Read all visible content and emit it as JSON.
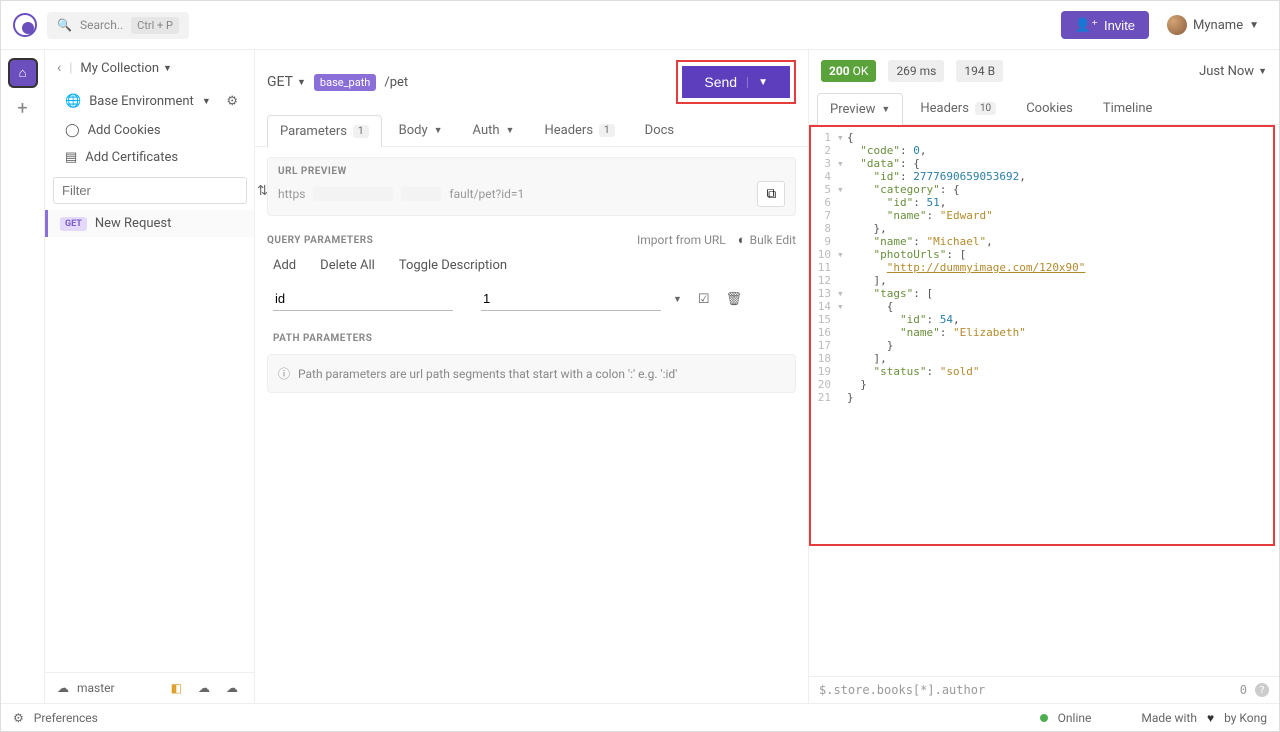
{
  "topbar": {
    "search_placeholder": "Search..",
    "shortcut": "Ctrl + P",
    "invite": "Invite",
    "username": "Myname"
  },
  "sidebar": {
    "collection": "My Collection",
    "env": "Base Environment",
    "add_cookies": "Add Cookies",
    "add_certs": "Add Certificates",
    "filter_placeholder": "Filter",
    "request": {
      "method": "GET",
      "name": "New Request"
    },
    "branch": "master"
  },
  "request": {
    "method": "GET",
    "base_tag": "base_path",
    "path": "/pet",
    "send": "Send",
    "tabs": {
      "parameters": "Parameters",
      "parameters_count": "1",
      "body": "Body",
      "auth": "Auth",
      "headers": "Headers",
      "headers_count": "1",
      "docs": "Docs"
    },
    "url_preview_label": "URL PREVIEW",
    "url_scheme": "https",
    "url_suffix": "fault/pet?id=1",
    "qp_label": "QUERY PARAMETERS",
    "import_url": "Import from URL",
    "bulk_edit": "Bulk Edit",
    "actions": {
      "add": "Add",
      "delete_all": "Delete All",
      "toggle": "Toggle Description"
    },
    "param": {
      "key": "id",
      "value": "1"
    },
    "pp_label": "PATH PARAMETERS",
    "pp_hint": "Path parameters are url path segments that start with a colon ':' e.g. ':id'"
  },
  "response": {
    "status_code": "200",
    "status_text": "OK",
    "time": "269 ms",
    "size": "194 B",
    "just_now": "Just Now",
    "tabs": {
      "preview": "Preview",
      "headers": "Headers",
      "headers_count": "10",
      "cookies": "Cookies",
      "timeline": "Timeline"
    },
    "lines": [
      {
        "n": "1",
        "f": "▾",
        "c": [
          [
            "p",
            "{"
          ]
        ]
      },
      {
        "n": "2",
        "f": "",
        "c": [
          [
            "i",
            "  "
          ],
          [
            "k",
            "\"code\""
          ],
          [
            "p",
            ": "
          ],
          [
            "n",
            "0"
          ],
          [
            "p",
            ","
          ]
        ]
      },
      {
        "n": "3",
        "f": "▾",
        "c": [
          [
            "i",
            "  "
          ],
          [
            "k",
            "\"data\""
          ],
          [
            "p",
            ": {"
          ]
        ]
      },
      {
        "n": "4",
        "f": "",
        "c": [
          [
            "i",
            "    "
          ],
          [
            "k",
            "\"id\""
          ],
          [
            "p",
            ": "
          ],
          [
            "n",
            "2777690659053692"
          ],
          [
            "p",
            ","
          ]
        ]
      },
      {
        "n": "5",
        "f": "▾",
        "c": [
          [
            "i",
            "    "
          ],
          [
            "k",
            "\"category\""
          ],
          [
            "p",
            ": {"
          ]
        ]
      },
      {
        "n": "6",
        "f": "",
        "c": [
          [
            "i",
            "      "
          ],
          [
            "k",
            "\"id\""
          ],
          [
            "p",
            ": "
          ],
          [
            "n",
            "51"
          ],
          [
            "p",
            ","
          ]
        ]
      },
      {
        "n": "7",
        "f": "",
        "c": [
          [
            "i",
            "      "
          ],
          [
            "k",
            "\"name\""
          ],
          [
            "p",
            ": "
          ],
          [
            "s",
            "\"Edward\""
          ]
        ]
      },
      {
        "n": "8",
        "f": "",
        "c": [
          [
            "i",
            "    "
          ],
          [
            "p",
            "},"
          ]
        ]
      },
      {
        "n": "9",
        "f": "",
        "c": [
          [
            "i",
            "    "
          ],
          [
            "k",
            "\"name\""
          ],
          [
            "p",
            ": "
          ],
          [
            "s",
            "\"Michael\""
          ],
          [
            "p",
            ","
          ]
        ]
      },
      {
        "n": "10",
        "f": "▾",
        "c": [
          [
            "i",
            "    "
          ],
          [
            "k",
            "\"photoUrls\""
          ],
          [
            "p",
            ": ["
          ]
        ]
      },
      {
        "n": "11",
        "f": "",
        "c": [
          [
            "i",
            "      "
          ],
          [
            "u",
            "\"http://dummyimage.com/120x90\""
          ]
        ]
      },
      {
        "n": "12",
        "f": "",
        "c": [
          [
            "i",
            "    "
          ],
          [
            "p",
            "],"
          ]
        ]
      },
      {
        "n": "13",
        "f": "▾",
        "c": [
          [
            "i",
            "    "
          ],
          [
            "k",
            "\"tags\""
          ],
          [
            "p",
            ": ["
          ]
        ]
      },
      {
        "n": "14",
        "f": "▾",
        "c": [
          [
            "i",
            "      "
          ],
          [
            "p",
            "{"
          ]
        ]
      },
      {
        "n": "15",
        "f": "",
        "c": [
          [
            "i",
            "        "
          ],
          [
            "k",
            "\"id\""
          ],
          [
            "p",
            ": "
          ],
          [
            "n",
            "54"
          ],
          [
            "p",
            ","
          ]
        ]
      },
      {
        "n": "16",
        "f": "",
        "c": [
          [
            "i",
            "        "
          ],
          [
            "k",
            "\"name\""
          ],
          [
            "p",
            ": "
          ],
          [
            "s",
            "\"Elizabeth\""
          ]
        ]
      },
      {
        "n": "17",
        "f": "",
        "c": [
          [
            "i",
            "      "
          ],
          [
            "p",
            "}"
          ]
        ]
      },
      {
        "n": "18",
        "f": "",
        "c": [
          [
            "i",
            "    "
          ],
          [
            "p",
            "],"
          ]
        ]
      },
      {
        "n": "19",
        "f": "",
        "c": [
          [
            "i",
            "    "
          ],
          [
            "k",
            "\"status\""
          ],
          [
            "p",
            ": "
          ],
          [
            "s",
            "\"sold\""
          ]
        ]
      },
      {
        "n": "20",
        "f": "",
        "c": [
          [
            "i",
            "  "
          ],
          [
            "p",
            "}"
          ]
        ]
      },
      {
        "n": "21",
        "f": "",
        "c": [
          [
            "p",
            "}"
          ]
        ]
      }
    ],
    "jsonpath": "$.store.books[*].author",
    "jsonpath_count": "0"
  },
  "footer": {
    "preferences": "Preferences",
    "online": "Online",
    "made": "Made with",
    "by": "by Kong"
  }
}
